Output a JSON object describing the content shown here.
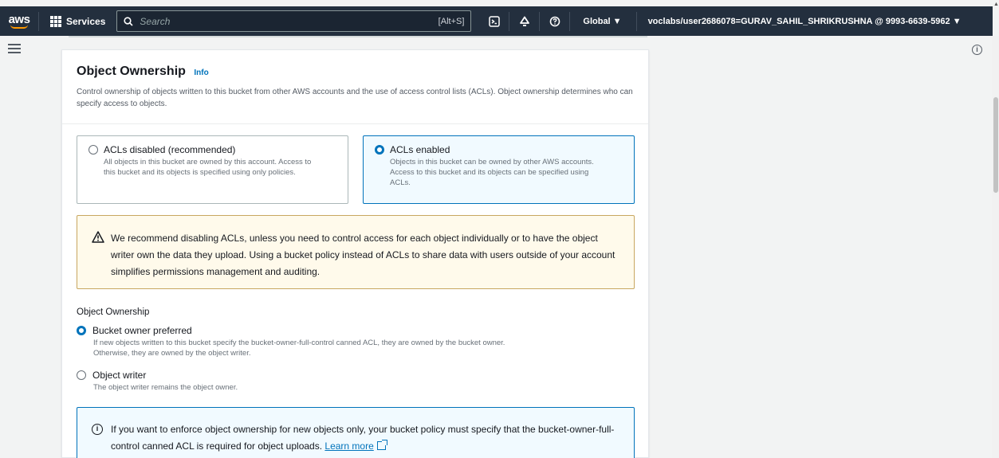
{
  "topbar": {
    "logo_text": "aws",
    "services_label": "Services",
    "search_placeholder": "Search",
    "search_shortcut": "[Alt+S]",
    "icons": [
      "cloudshell-icon",
      "notifications-icon",
      "help-icon"
    ],
    "region_label": "Global ▼",
    "account_label": "voclabs/user2686078=GURAV_SAHIL_SHRIKRUSHNA @ 9993-6639-5962 ▼"
  },
  "colors": {
    "nav_bg": "#232f3e",
    "accent": "#0073bb",
    "logo_smile": "#ff9900",
    "warning_bg": "#fffaeb",
    "info_bg": "#f1faff"
  },
  "section": {
    "title": "Object Ownership",
    "info_link": "Info",
    "description": "Control ownership of objects written to this bucket from other AWS accounts and the use of access control lists (ACLs). Object ownership determines who can specify access to objects."
  },
  "acl_tiles": [
    {
      "title": "ACLs disabled (recommended)",
      "description": "All objects in this bucket are owned by this account. Access to this bucket and its objects is specified using only policies.",
      "selected": false
    },
    {
      "title": "ACLs enabled",
      "description": "Objects in this bucket can be owned by other AWS accounts. Access to this bucket and its objects can be specified using ACLs.",
      "selected": true
    }
  ],
  "warning": {
    "text": "We recommend disabling ACLs, unless you need to control access for each object individually or to have the object writer own the data they upload. Using a bucket policy instead of ACLs to share data with users outside of your account simplifies permissions management and auditing."
  },
  "ownership": {
    "label": "Object Ownership",
    "options": [
      {
        "title": "Bucket owner preferred",
        "description": "If new objects written to this bucket specify the bucket-owner-full-control canned ACL, they are owned by the bucket owner. Otherwise, they are owned by the object writer.",
        "selected": true
      },
      {
        "title": "Object writer",
        "description": "The object writer remains the object owner.",
        "selected": false
      }
    ]
  },
  "info_alert": {
    "text": "If you want to enforce object ownership for new objects only, your bucket policy must specify that the bucket-owner-full-control canned ACL is required for object uploads.",
    "link": "Learn more"
  }
}
